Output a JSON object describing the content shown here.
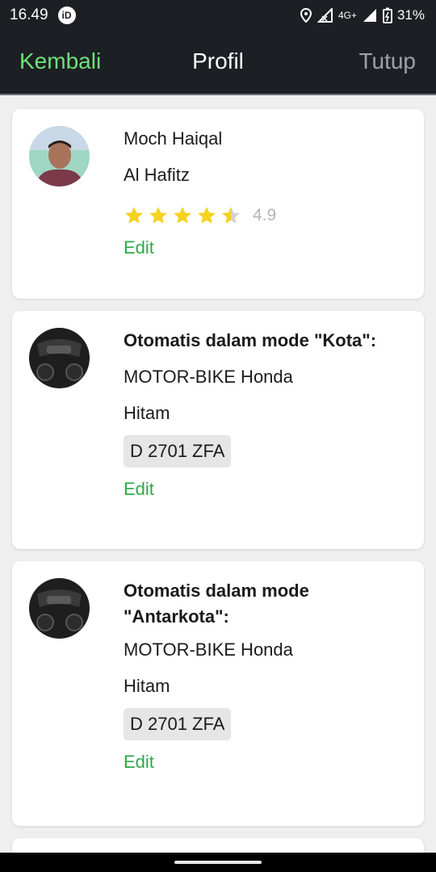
{
  "status_bar": {
    "time": "16.49",
    "app_badge": "iD",
    "network": "4G+",
    "battery": "31%"
  },
  "nav": {
    "back_label": "Kembali",
    "title": "Profil",
    "close_label": "Tutup"
  },
  "profile": {
    "first_name": "Moch Haiqal",
    "last_name": "Al Hafitz",
    "rating": "4.9",
    "rating_value": 4.5,
    "star_color": "#f6d21c",
    "edit_label": "Edit"
  },
  "vehicles": [
    {
      "mode_line1": "Otomatis dalam mode \"Kota\":",
      "mode_line2": "",
      "vehicle": "MOTOR-BIKE Honda",
      "color": "Hitam",
      "plate": "D 2701 ZFA",
      "edit_label": "Edit"
    },
    {
      "mode_line1": "Otomatis dalam mode",
      "mode_line2": "\"Antarkota\":",
      "vehicle": "MOTOR-BIKE Honda",
      "color": "Hitam",
      "plate": "D 2701 ZFA",
      "edit_label": "Edit"
    }
  ],
  "colors": {
    "accent_green": "#2fa84a",
    "nav_back_green": "#6ee07a",
    "nav_bg": "#1c1f23"
  }
}
